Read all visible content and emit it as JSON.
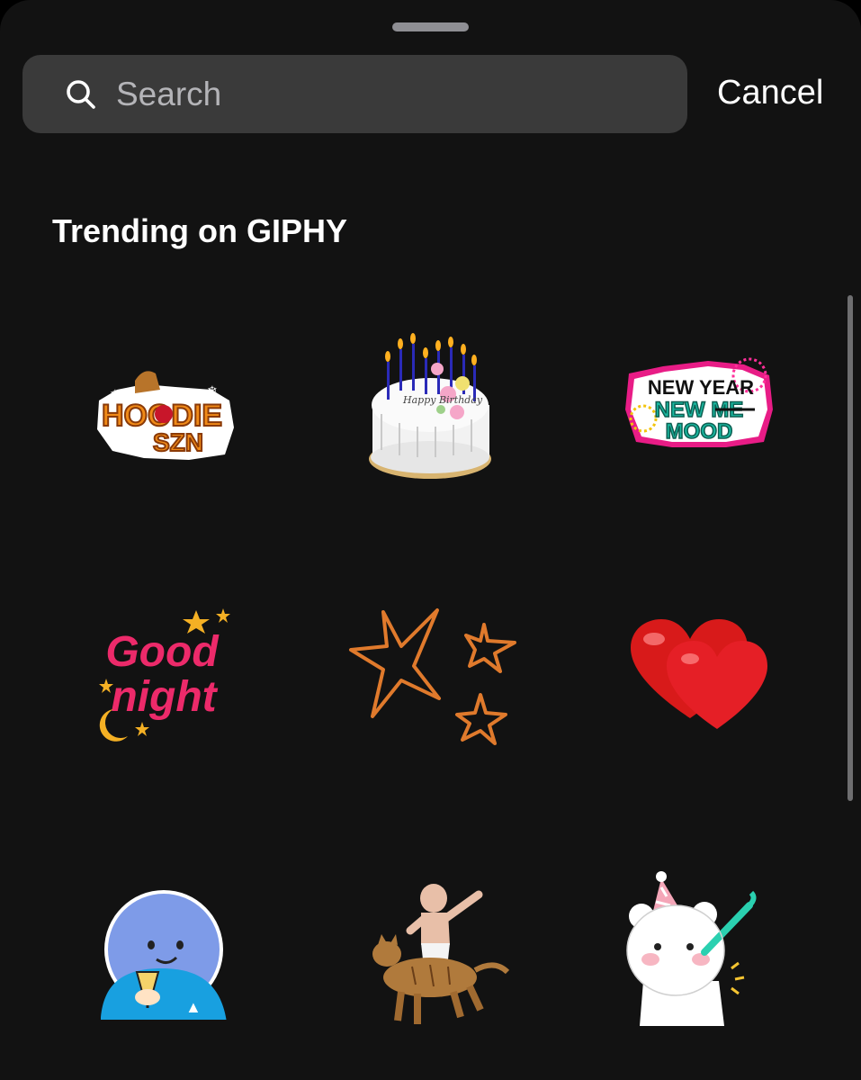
{
  "search": {
    "placeholder": "Search",
    "cancel_label": "Cancel"
  },
  "section": {
    "title": "Trending on GIPHY"
  },
  "stickers": [
    {
      "name": "hoodie-szn",
      "text_line1": "HOODIE",
      "text_line2": "SZN"
    },
    {
      "name": "birthday-cake",
      "text": "Happy Birthday"
    },
    {
      "name": "new-year-new-me-mood",
      "text_line1": "NEW YEAR",
      "text_line2": "NEW ME",
      "text_line3": "MOOD"
    },
    {
      "name": "good-night",
      "text_line1": "Good",
      "text_line2": "night"
    },
    {
      "name": "orange-stars"
    },
    {
      "name": "red-hearts"
    },
    {
      "name": "blue-character-toast"
    },
    {
      "name": "baby-riding-cat"
    },
    {
      "name": "party-bear"
    }
  ],
  "colors": {
    "background": "#121212",
    "search_field": "#3a3a3a",
    "text": "#ffffff",
    "placeholder": "#b4b4b8"
  }
}
